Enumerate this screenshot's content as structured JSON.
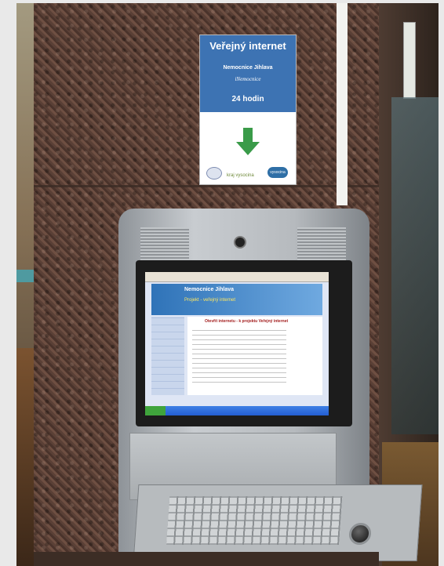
{
  "sign": {
    "title": "Veřejný internet",
    "hospital": "Nemocnice Jihlava",
    "italic": "iNemocnice",
    "hours": "24 hodin",
    "logo_middle": "kraj vysocina",
    "logo_right": "vysocina",
    "accent_color": "#3d73b3",
    "arrow_color": "#3a9b49"
  },
  "kiosk": {
    "screen": {
      "banner_title": "Nemocnice Jihlava",
      "banner_subtitle": "Projekt - veřejný internet",
      "heading": "Otevřít internetu - k projektu Veřejný internet"
    }
  },
  "icons": [
    "down-arrow-icon",
    "camera-icon",
    "trackball-icon",
    "speaker-grille-icon"
  ]
}
